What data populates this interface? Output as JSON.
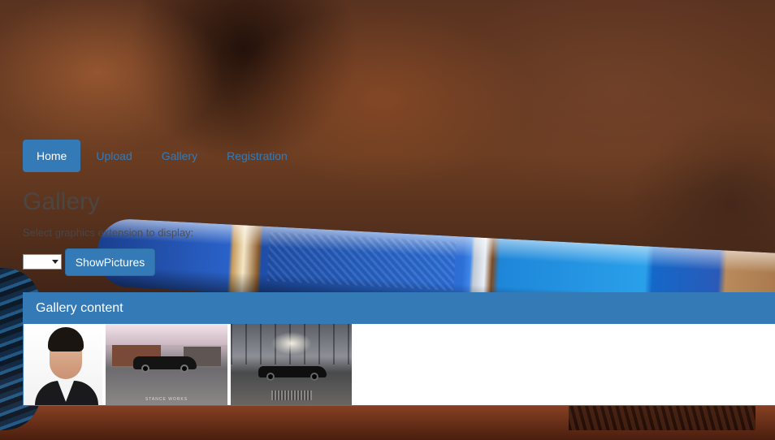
{
  "nav": {
    "items": [
      {
        "label": "Home",
        "active": true
      },
      {
        "label": "Upload",
        "active": false
      },
      {
        "label": "Gallery",
        "active": false
      },
      {
        "label": "Registration",
        "active": false
      }
    ]
  },
  "page": {
    "title": "Gallery",
    "hint": "Select graphics extension to display:"
  },
  "controls": {
    "extension_selected": "",
    "show_button_label": "ShowPictures"
  },
  "gallery": {
    "heading": "Gallery content",
    "thumbnails": [
      {
        "subject": "portrait-man"
      },
      {
        "subject": "car-garage",
        "caption": "STANCE WORKS"
      },
      {
        "subject": "car-industrial-hall"
      }
    ]
  },
  "colors": {
    "primary": "#337ab7",
    "primary_border": "#2e6da4",
    "text_muted": "#4a4a4a"
  },
  "icons": {
    "select_chevron": "chevron-down-icon"
  }
}
